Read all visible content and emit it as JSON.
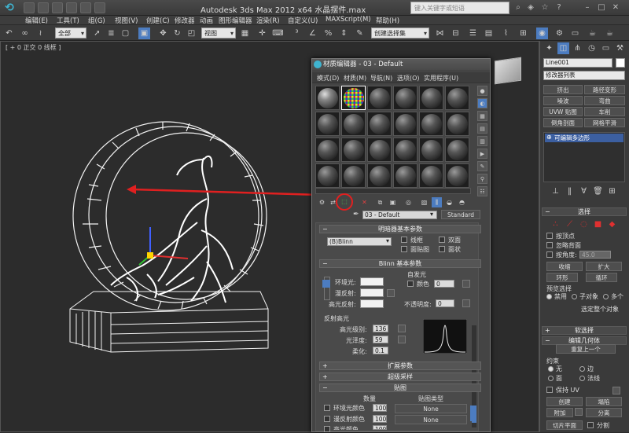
{
  "app": {
    "title": "Autodesk 3ds Max  2012 x64  水晶摆件.max",
    "search_placeholder": "键入关键字或短语"
  },
  "menu": [
    "编辑(E)",
    "工具(T)",
    "组(G)",
    "视图(V)",
    "创建(C)",
    "修改器",
    "动画",
    "图形编辑器",
    "渲染(R)",
    "自定义(U)",
    "MAXScript(M)",
    "帮助(H)"
  ],
  "toolbar": {
    "selection_filter": "全部",
    "ref_coord": "视图",
    "named_selection": "创建选择集"
  },
  "viewport": {
    "label": "[ + 0 正交 0 线框 ]"
  },
  "material_editor": {
    "title": "材质编辑器 - 03 - Default",
    "menu": [
      "模式(D)",
      "材质(M)",
      "导航(N)",
      "选项(O)",
      "实用程序(U)"
    ],
    "material_name": "03 - Default",
    "material_type": "Standard",
    "shader_basic_header": "明暗器基本参数",
    "shader_type": "(B)Blinn",
    "shader_opts": [
      "线框",
      "双面",
      "面贴图",
      "面状"
    ],
    "blinn_header": "Blinn 基本参数",
    "self_illum": "自发光",
    "color_label": "颜色",
    "self_illum_value": "0",
    "ambient_label": "环境光:",
    "diffuse_label": "漫反射:",
    "specular_label": "高光反射:",
    "opacity_label": "不透明度:",
    "opacity_value": "0",
    "spec_highlights": "反射高光",
    "spec_level_label": "高光级别:",
    "spec_level_value": "136",
    "gloss_label": "光泽度:",
    "gloss_value": "59",
    "soften_label": "柔化:",
    "soften_value": "0.1",
    "extended_header": "扩展参数",
    "supersampling_header": "超级采样",
    "maps_header": "贴图",
    "maps_amount": "数量",
    "maps_type": "贴图类型",
    "maps": [
      {
        "label": "环境光颜色",
        "amount": "100",
        "map": "None"
      },
      {
        "label": "漫反射颜色",
        "amount": "100",
        "map": "None"
      },
      {
        "label": "高光颜色",
        "amount": "100",
        "map": "None"
      }
    ]
  },
  "command_panel": {
    "object_name": "Line001",
    "modifier_list": "修改器列表",
    "buttons": [
      "挤出",
      "路径变形",
      "噪波",
      "弯曲",
      "UVW 贴图",
      "车削",
      "倒角剖面",
      "网格平滑"
    ],
    "stack_item": "可编辑多边形",
    "selection_header": "选择",
    "by_vertex": "按顶点",
    "ignore_backfacing": "忽略背面",
    "by_angle": "按角度:",
    "by_angle_value": "45.0",
    "shrink": "收缩",
    "grow": "扩大",
    "ring": "环形",
    "loop": "循环",
    "preview_selection": "预览选择",
    "preview_options": [
      "禁用",
      "子对象",
      "多个"
    ],
    "select_whole": "选定整个对象",
    "soft_selection_header": "软选择",
    "edit_geometry_header": "编辑几何体",
    "repeat_last": "重复上一个",
    "constraints": "约束",
    "constraint_options": [
      "无",
      "边",
      "面",
      "法线"
    ],
    "preserve_uvs": "保持 UV",
    "create": "创建",
    "collapse": "塌陷",
    "attach": "附加",
    "detach": "分离",
    "slice_plane": "切片平面",
    "split": "分割"
  }
}
